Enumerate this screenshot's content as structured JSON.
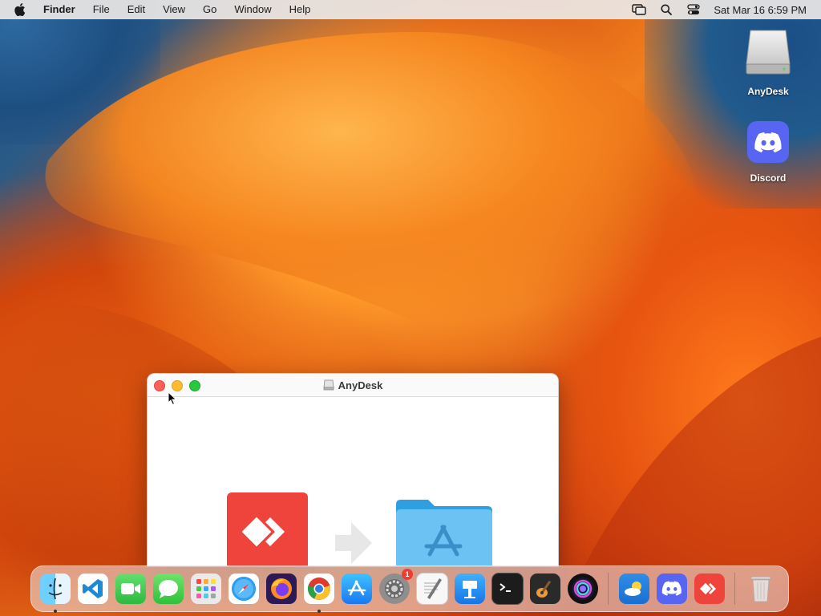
{
  "menubar": {
    "app_name": "Finder",
    "items": [
      "File",
      "Edit",
      "View",
      "Go",
      "Window",
      "Help"
    ],
    "clock": "Sat Mar 16  6:59 PM"
  },
  "desktop": {
    "icons": [
      {
        "label": "AnyDesk",
        "icon": "disk-image-icon"
      },
      {
        "label": "Discord",
        "icon": "discord-icon"
      }
    ]
  },
  "window": {
    "title": "AnyDesk"
  },
  "dock": {
    "items": [
      {
        "name": "Finder",
        "running": true
      },
      {
        "name": "Visual Studio Code",
        "running": false
      },
      {
        "name": "FaceTime",
        "running": false
      },
      {
        "name": "Messages",
        "running": false
      },
      {
        "name": "Launchpad",
        "running": false
      },
      {
        "name": "Safari",
        "running": false
      },
      {
        "name": "Firefox",
        "running": false
      },
      {
        "name": "Google Chrome",
        "running": true
      },
      {
        "name": "App Store",
        "running": false
      },
      {
        "name": "System Settings",
        "running": false,
        "badge": "1"
      },
      {
        "name": "TextEdit",
        "running": false
      },
      {
        "name": "Keynote",
        "running": false
      },
      {
        "name": "Terminal",
        "running": false
      },
      {
        "name": "GarageBand",
        "running": false
      },
      {
        "name": "Siri",
        "running": false
      },
      {
        "name": "Weather",
        "running": false
      },
      {
        "name": "Discord",
        "running": false
      },
      {
        "name": "AnyDesk",
        "running": false
      },
      {
        "name": "Trash",
        "running": false
      }
    ]
  },
  "colors": {
    "anydesk_red": "#ef443b",
    "discord_blurple": "#5865f2",
    "folder_blue": "#6cc3f3"
  }
}
